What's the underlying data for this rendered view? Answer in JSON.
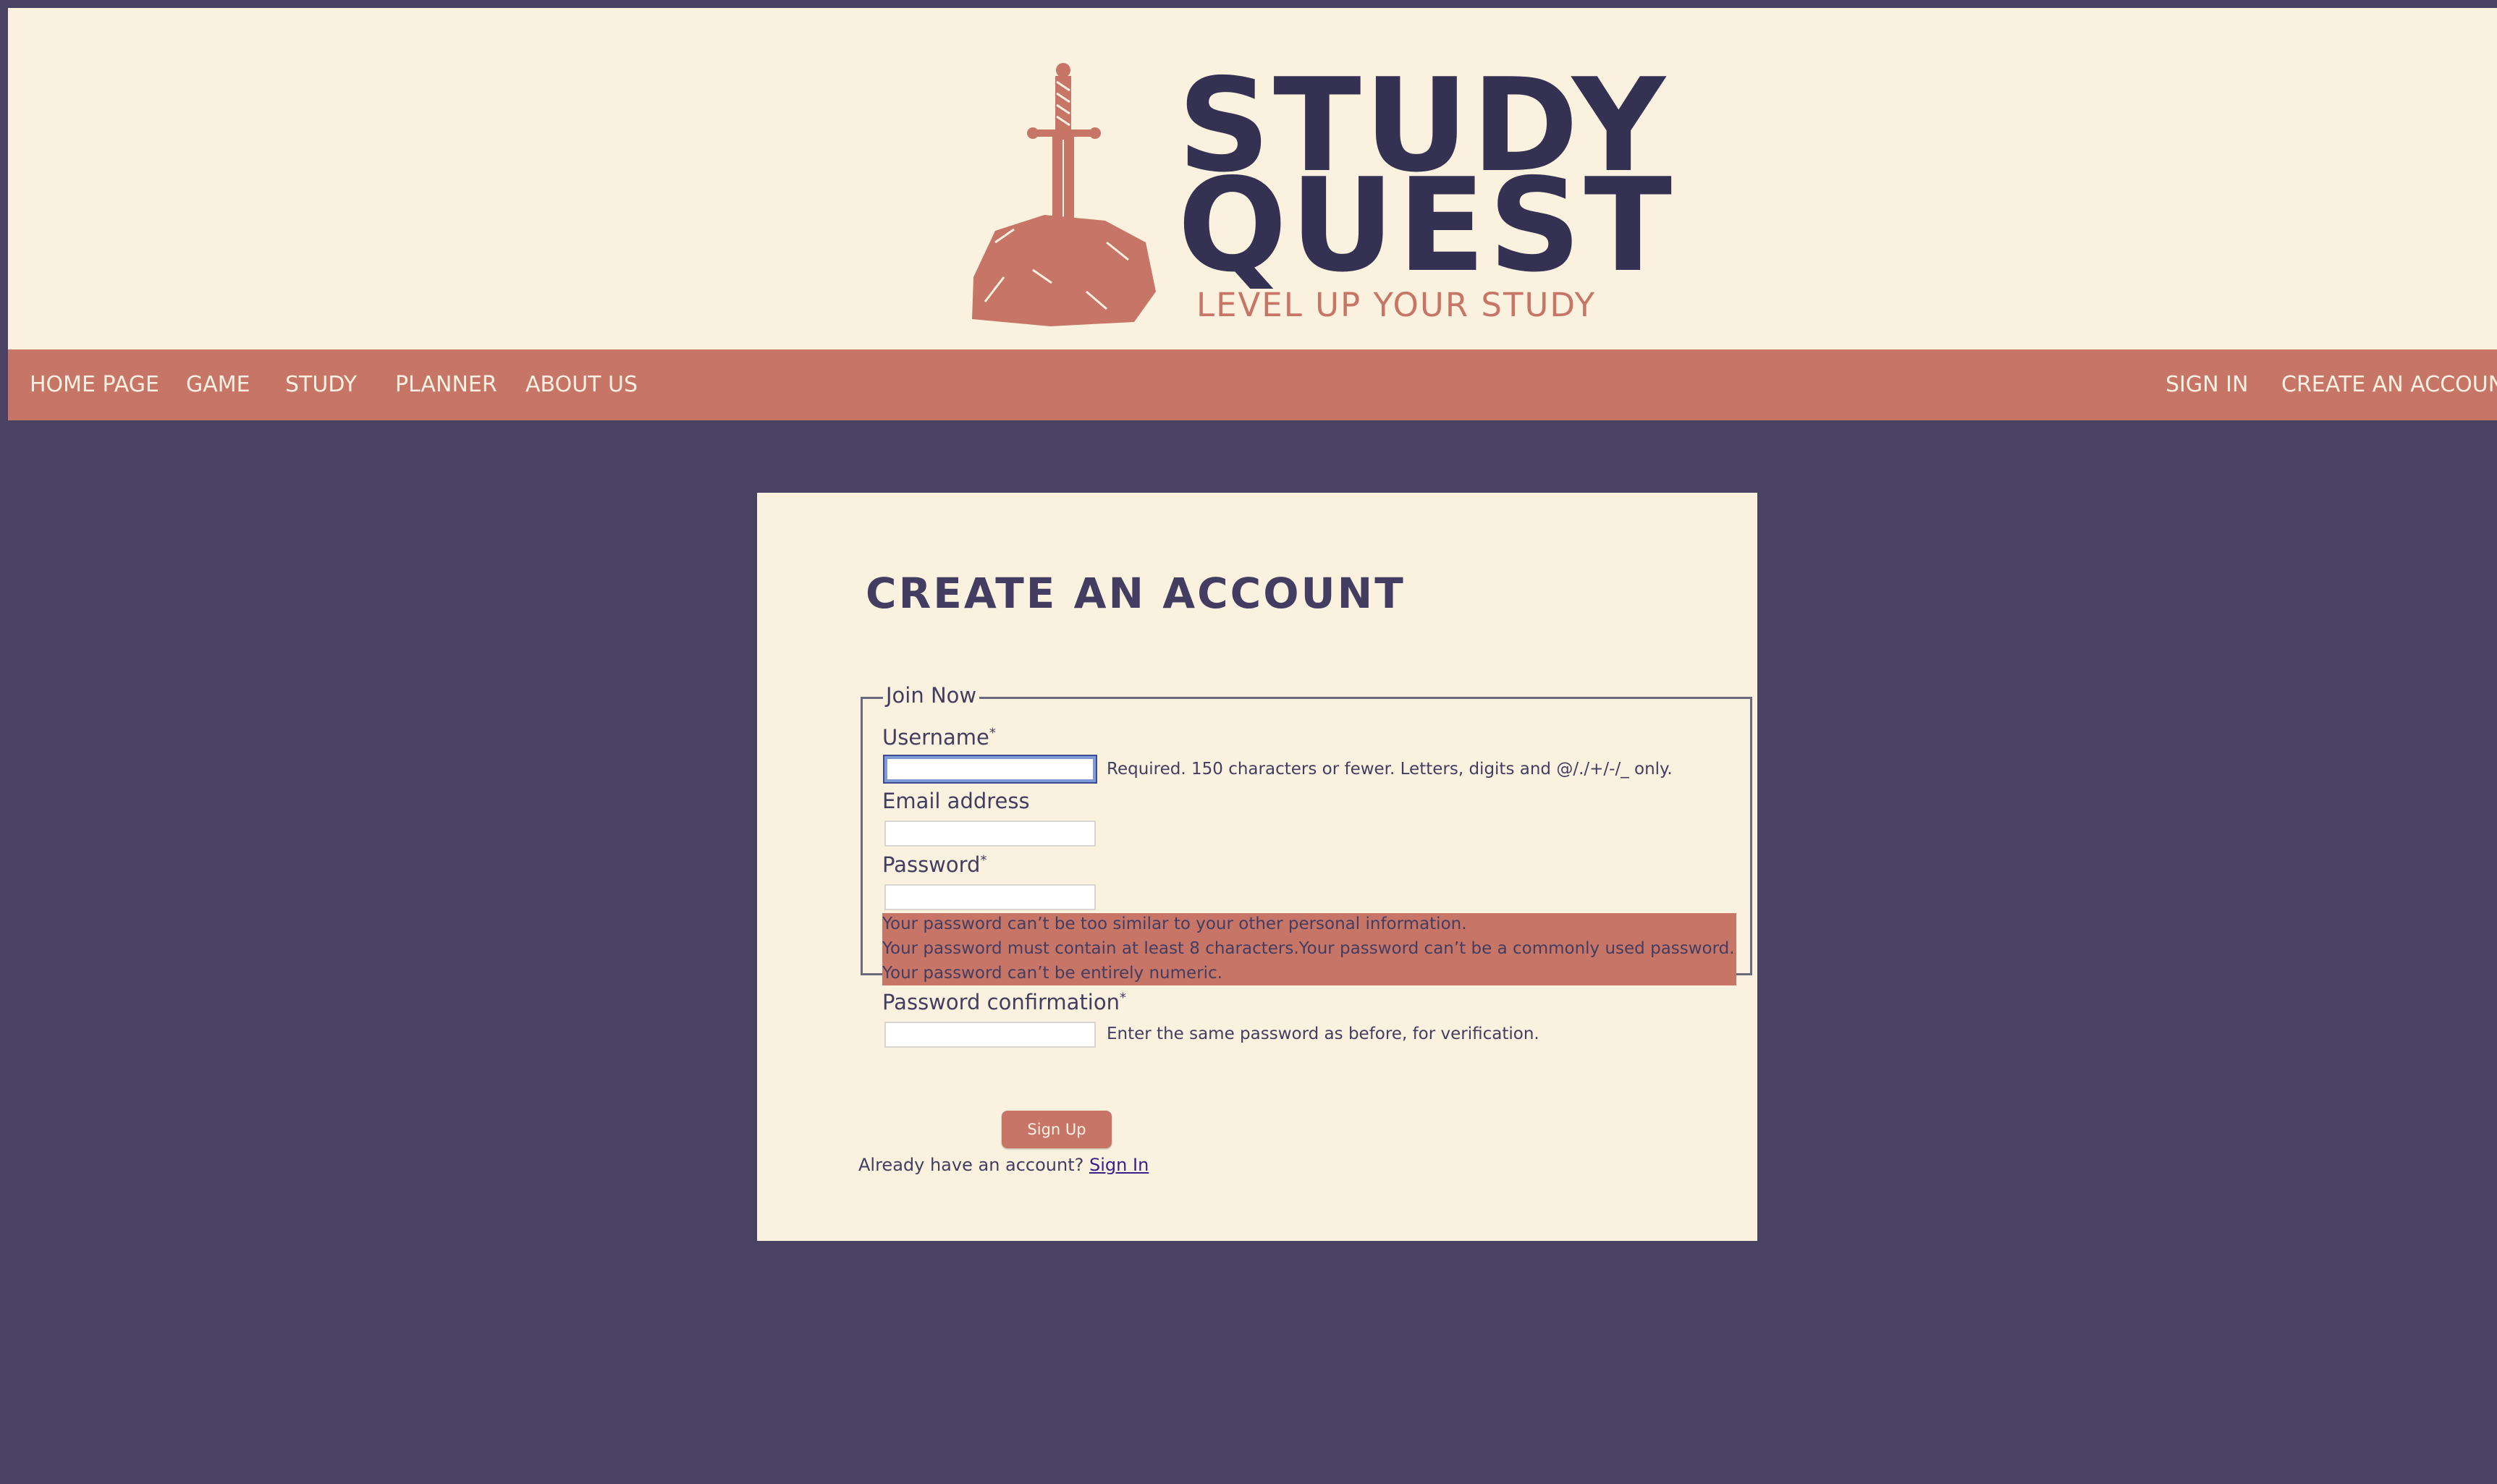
{
  "brand": {
    "line1": "STUDY",
    "line2": "QUEST",
    "tagline": "LEVEL UP YOUR STUDY",
    "logo_icon": "sword-in-stone-icon"
  },
  "nav": {
    "left": [
      "HOME PAGE",
      "GAME",
      "STUDY",
      "PLANNER",
      "ABOUT US"
    ],
    "right": [
      "SIGN IN",
      "CREATE AN ACCOUNT"
    ]
  },
  "page": {
    "title": "CREATE AN ACCOUNT"
  },
  "form": {
    "legend": "Join Now",
    "required_marker": "*",
    "username": {
      "label": "Username",
      "value": "",
      "help": "Required. 150 characters or fewer. Letters, digits and @/./+/-/_ only."
    },
    "email": {
      "label": "Email address",
      "value": ""
    },
    "password": {
      "label": "Password",
      "value": "",
      "errors": [
        "Your password can’t be too similar to your other personal information.",
        "Your password must contain at least 8 characters.Your password can’t be a commonly used password.",
        "Your password can’t be entirely numeric."
      ]
    },
    "password_confirmation": {
      "label": "Password confirmation",
      "value": "",
      "help": "Enter the same password as before, for verification."
    },
    "submit_label": "Sign Up",
    "already_text": "Already have an account?",
    "signin_link": "Sign In"
  },
  "colors": {
    "background": "#494262",
    "header_bg": "#faf2de",
    "accent": "#c77566",
    "brand_dark": "#353152"
  }
}
